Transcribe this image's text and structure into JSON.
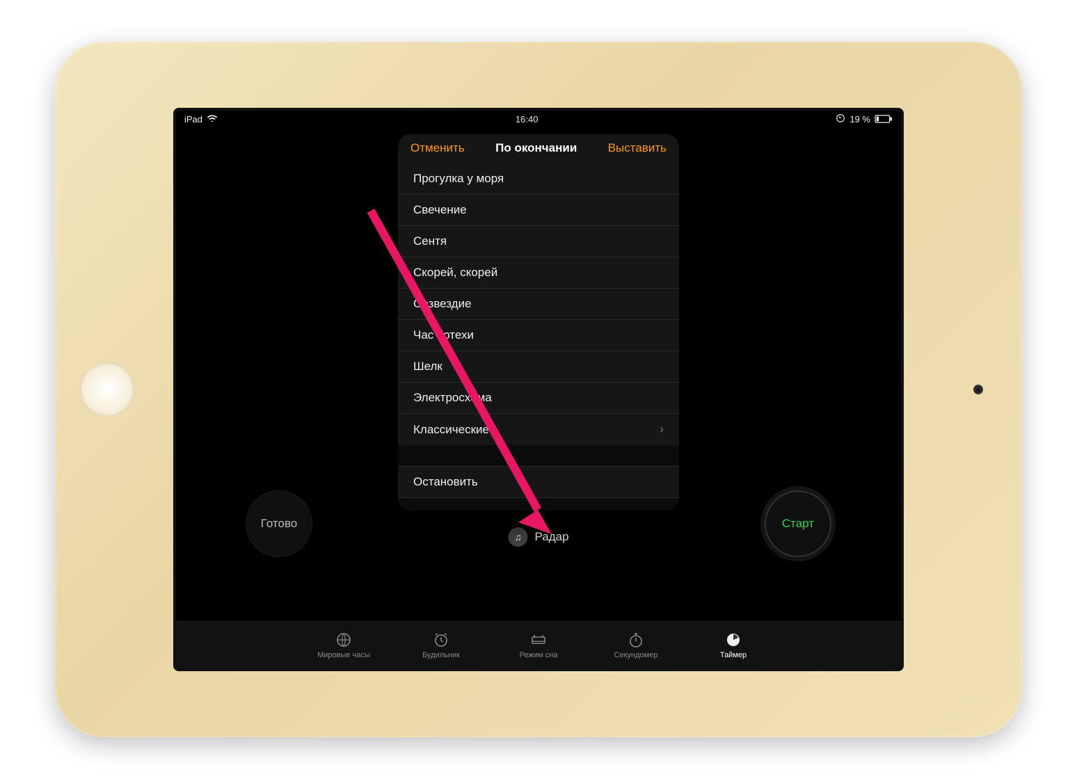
{
  "status": {
    "device": "iPad",
    "time": "16:40",
    "battery": "19 %"
  },
  "popover": {
    "cancel": "Отменить",
    "title": "По окончании",
    "set": "Выставить",
    "items": [
      "Прогулка у моря",
      "Свечение",
      "Сентя",
      "Скорей, скорей",
      "Созвездие",
      "Час потехи",
      "Шелк",
      "Электросхема"
    ],
    "classic_label": "Классические",
    "stop_label": "Остановить"
  },
  "buttons": {
    "done": "Готово",
    "start": "Старт"
  },
  "sound": {
    "label": "Радар"
  },
  "tabs": {
    "world": "Мировые часы",
    "alarm": "Будильник",
    "sleep": "Режим сна",
    "stopwatch": "Секундомер",
    "timer": "Таймер"
  }
}
